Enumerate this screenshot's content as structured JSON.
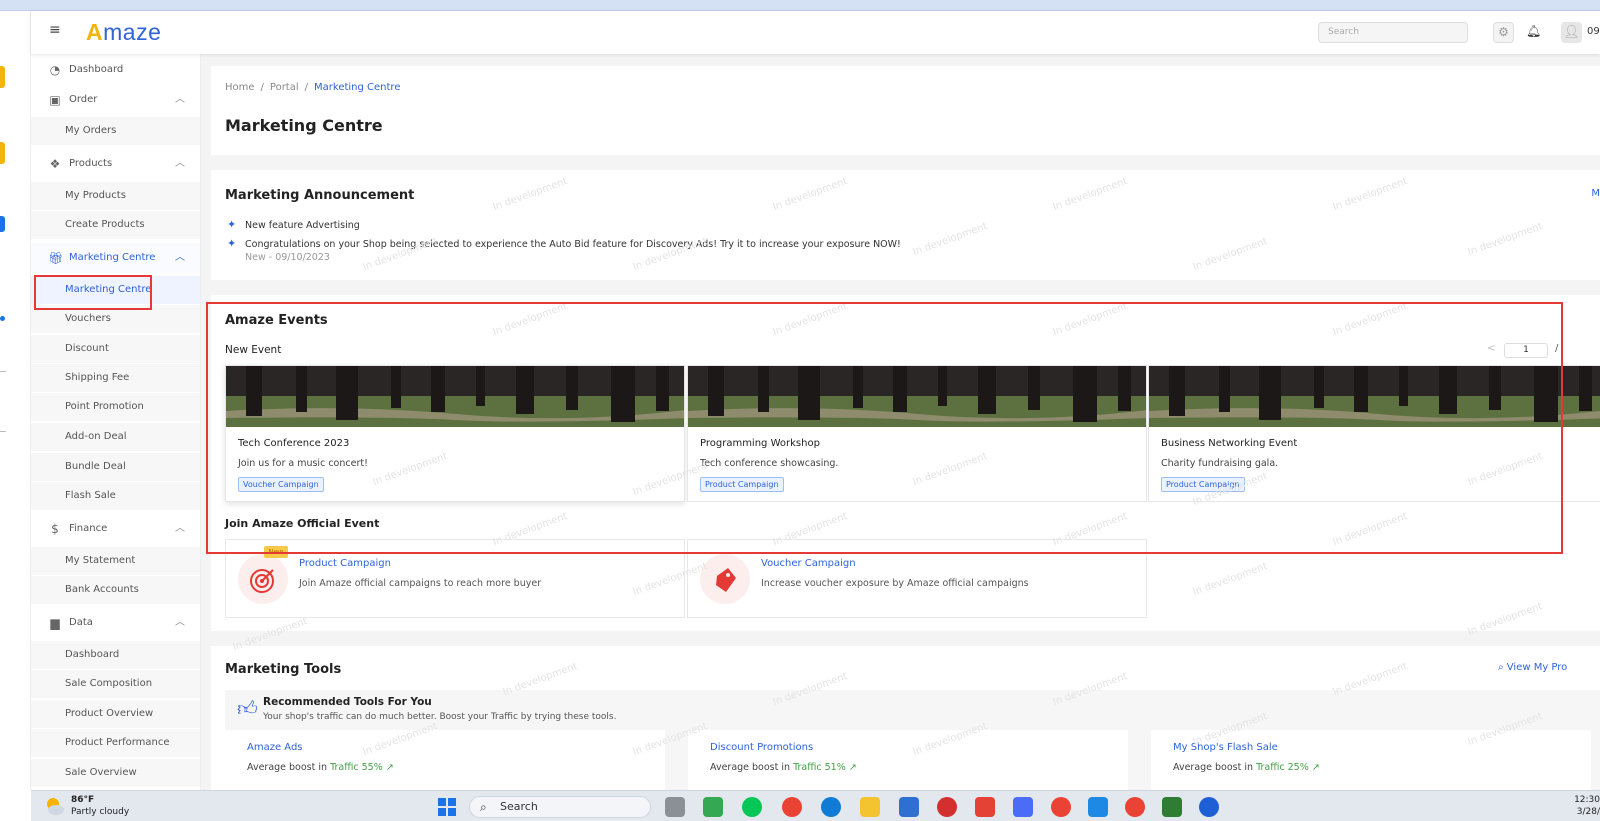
{
  "header": {
    "logo_text": "mazе",
    "logo_a": "A",
    "search_placeholder": "Search",
    "user_fragment": "09"
  },
  "sidebar": {
    "dashboard": "Dashboard",
    "order": "Order",
    "my_orders": "My Orders",
    "products": "Products",
    "my_products": "My Products",
    "create_products": "Create Products",
    "marketing_centre": "Marketing Centre",
    "marketing_centre_sub": "Marketing Centre",
    "vouchers": "Vouchers",
    "discount": "Discount",
    "shipping_fee": "Shipping Fee",
    "point_promotion": "Point Promotion",
    "add_on_deal": "Add-on Deal",
    "bundle_deal": "Bundle Deal",
    "flash_sale": "Flash Sale",
    "finance": "Finance",
    "my_statement": "My Statement",
    "bank_accounts": "Bank Accounts",
    "data": "Data",
    "data_dashboard": "Dashboard",
    "sale_composition": "Sale Composition",
    "product_overview": "Product Overview",
    "product_performance": "Product Performance",
    "sale_overview": "Sale Overview"
  },
  "breadcrumb": {
    "home": "Home",
    "portal": "Portal",
    "current": "Marketing Centre",
    "sep": "/"
  },
  "page_title": "Marketing Centre",
  "announcement": {
    "title": "Marketing Announcement",
    "more": "M",
    "item_title": "New feature Advertising",
    "item_text": "Congratulations on your Shop being selected to experience the Auto Bid feature for Discovery Ads! Try it to increase your exposure NOW!",
    "item_meta": "New - 09/10/2023"
  },
  "events": {
    "title": "Amaze Events",
    "new_event": "New Event",
    "pager_value": "1",
    "pager_sep": "/",
    "pager_prev": "<",
    "cards": [
      {
        "name": "Tech Conference 2023",
        "desc": "Join us for a music concert!",
        "tag": "Voucher Campaign"
      },
      {
        "name": "Programming Workshop",
        "desc": "Tech conference showcasing.",
        "tag": "Product Campaign"
      },
      {
        "name": "Business Networking Event",
        "desc": "Charity fundraising gala.",
        "tag": "Product Campaign"
      }
    ],
    "join_title": "Join Amaze Official Event",
    "join_cards": [
      {
        "title": "Product Campaign",
        "desc": "Join Amaze official campaigns to reach more buyer",
        "badge": "New"
      },
      {
        "title": "Voucher Campaign",
        "desc": "Increase voucher exposure by Amaze official campaigns"
      }
    ]
  },
  "tools": {
    "title": "Marketing Tools",
    "view_link": "View My Pro",
    "rec_title": "Recommended Tools For You",
    "rec_sub": "Your shop's traffic can do much better. Boost your Traffic by trying these tools.",
    "cards": [
      {
        "name": "Amaze Ads",
        "prefix": "Average boost in ",
        "metric": "Traffic 55%"
      },
      {
        "name": "Discount Promotions",
        "prefix": "Average boost in ",
        "metric": "Traffic 51%"
      },
      {
        "name": "My Shop's Flash Sale",
        "prefix": "Average boost in ",
        "metric": "Traffic 25%"
      }
    ]
  },
  "watermark": "In development",
  "taskbar": {
    "temp": "86°F",
    "weather": "Partly cloudy",
    "search": "Search",
    "time": "12:30",
    "date": "3/28/"
  },
  "colors": {
    "accent": "#2f63d8",
    "highlight": "#e53935",
    "positive": "#43a047"
  }
}
